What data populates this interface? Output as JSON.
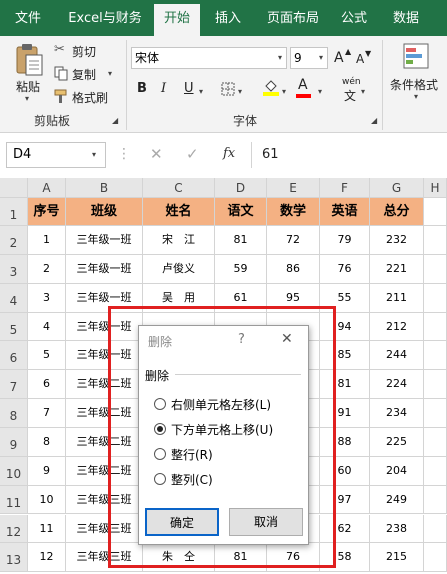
{
  "tabs": [
    "文件",
    "Excel与财务",
    "开始",
    "插入",
    "页面布局",
    "公式",
    "数据"
  ],
  "active_tab": "开始",
  "ribbon": {
    "paste": "粘贴",
    "cut": "剪切",
    "copy": "复制",
    "format_painter": "格式刷",
    "clipboard_group": "剪贴板",
    "font_name": "宋体",
    "font_size": "9",
    "bold": "B",
    "italic": "I",
    "underline": "U",
    "grow_font": "A",
    "shrink_font": "A",
    "font_color_letter": "A",
    "phonetic": "wén",
    "font_group": "字体",
    "conditional_format": "条件格式",
    "fill_color": "#ffff00",
    "font_color": "#ff0000"
  },
  "formula_bar": {
    "name_box": "D4",
    "fx": "fx",
    "value": "61"
  },
  "sheet": {
    "columns": [
      "A",
      "B",
      "C",
      "D",
      "E",
      "F",
      "G",
      "H"
    ],
    "rows": [
      "1",
      "2",
      "3",
      "4",
      "5",
      "6",
      "7",
      "8",
      "9",
      "10",
      "11",
      "12",
      "13"
    ],
    "headers": [
      "序号",
      "班级",
      "姓名",
      "语文",
      "数学",
      "英语",
      "总分"
    ],
    "data": [
      [
        "1",
        "三年级一班",
        "宋　江",
        "81",
        "72",
        "79",
        "232"
      ],
      [
        "2",
        "三年级一班",
        "卢俊义",
        "59",
        "86",
        "76",
        "221"
      ],
      [
        "3",
        "三年级一班",
        "吴　用",
        "61",
        "95",
        "55",
        "211"
      ],
      [
        "4",
        "三年级一班",
        "",
        "",
        "",
        "94",
        "212"
      ],
      [
        "5",
        "三年级一班",
        "",
        "",
        "",
        "85",
        "244"
      ],
      [
        "6",
        "三年级二班",
        "",
        "",
        "",
        "81",
        "224"
      ],
      [
        "7",
        "三年级二班",
        "",
        "",
        "",
        "91",
        "234"
      ],
      [
        "8",
        "三年级二班",
        "",
        "",
        "",
        "88",
        "225"
      ],
      [
        "9",
        "三年级二班",
        "",
        "",
        "",
        "60",
        "204"
      ],
      [
        "10",
        "三年级三班",
        "",
        "",
        "",
        "97",
        "249"
      ],
      [
        "11",
        "三年级三班",
        "",
        "",
        "",
        "62",
        "238"
      ],
      [
        "12",
        "三年级三班",
        "朱　仝",
        "81",
        "76",
        "58",
        "215"
      ]
    ],
    "header_fill": "#f4b183"
  },
  "dialog": {
    "title": "删除",
    "help": "?",
    "close": "✕",
    "group_label": "删除",
    "options": [
      "右侧单元格左移(L)",
      "下方单元格上移(U)",
      "整行(R)",
      "整列(C)"
    ],
    "selected_index": 1,
    "ok": "确定",
    "cancel": "取消"
  }
}
